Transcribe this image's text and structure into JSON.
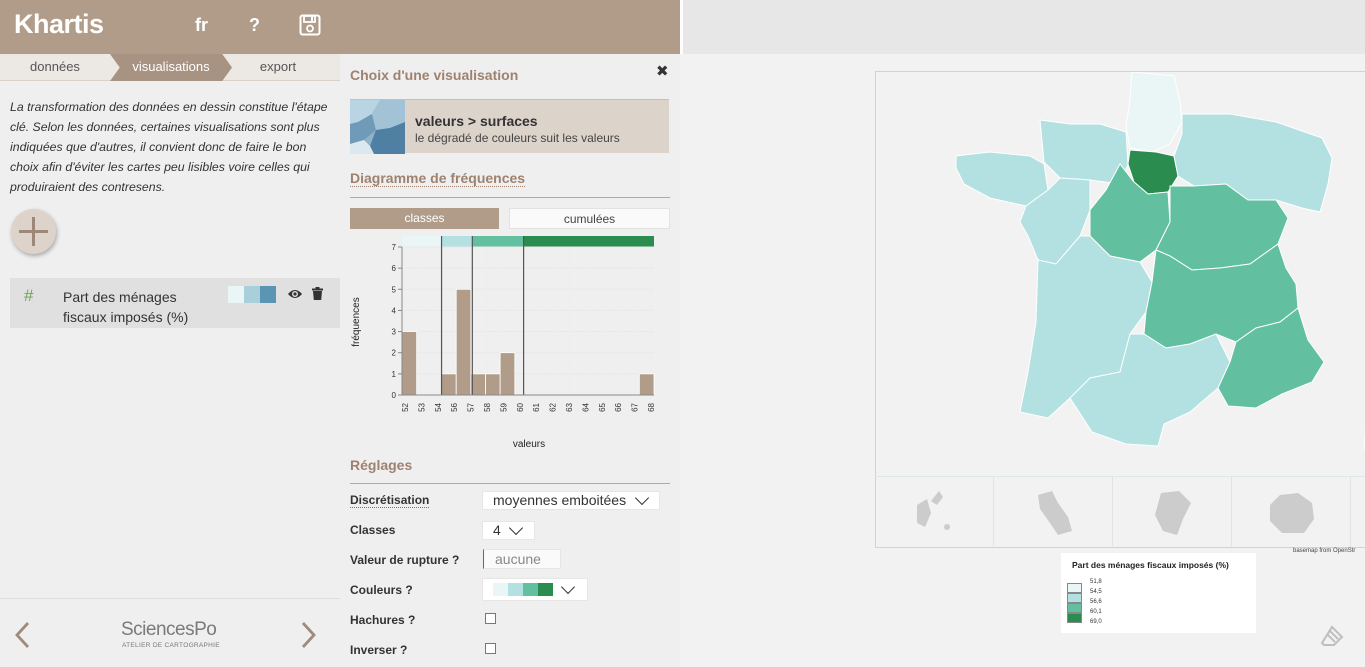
{
  "app": {
    "logo": "Khartis",
    "lang": "fr",
    "help": "?",
    "colors": {
      "accent": "#b19c8a",
      "accent_dark": "#9e8270",
      "accent_step": "#a89282"
    }
  },
  "steps": [
    {
      "label": "données",
      "active": false
    },
    {
      "label": "visualisations",
      "active": true
    },
    {
      "label": "export",
      "active": false
    }
  ],
  "intro": "La transformation des données en dessin constitue l'étape clé. Selon les données, certaines visualisations sont plus indiquées que d'autres, il convient donc de faire le bon choix afin d'éviter les cartes peu lisibles voire celles qui produiraient des contresens.",
  "layer": {
    "symbol": "#",
    "name": "Part des ménages fiscaux imposés (%)",
    "swatch": [
      "#eaf5f6",
      "#a9cfdb",
      "#5a95b4"
    ]
  },
  "footer": {
    "brand": "SciencesPo",
    "subtitle": "ATELIER DE CARTOGRAPHIE"
  },
  "choice": {
    "title": "Choix d'une visualisation",
    "vis_title": "valeurs > surfaces",
    "vis_desc": "le dégradé de couleurs suit les valeurs"
  },
  "freq": {
    "title": "Diagramme de fréquences",
    "tab_classes": "classes",
    "tab_cumul": "cumulées"
  },
  "chart_data": {
    "type": "bar",
    "xlabel": "valeurs",
    "ylabel": "fréquences",
    "x_ticks": [
      "52",
      "53",
      "54",
      "56",
      "57",
      "58",
      "59",
      "60",
      "61",
      "62",
      "63",
      "64",
      "65",
      "66",
      "67",
      "68"
    ],
    "yticks": [
      0,
      1,
      2,
      3,
      4,
      5,
      6,
      7
    ],
    "ylim": [
      0,
      7
    ],
    "xlim": [
      51.8,
      69.0
    ],
    "bins": [
      {
        "x0": 51.8,
        "x1": 52.8,
        "count": 3
      },
      {
        "x0": 54.5,
        "x1": 55.5,
        "count": 1
      },
      {
        "x0": 55.5,
        "x1": 56.5,
        "count": 5
      },
      {
        "x0": 56.5,
        "x1": 57.5,
        "count": 1
      },
      {
        "x0": 57.5,
        "x1": 58.5,
        "count": 1
      },
      {
        "x0": 58.5,
        "x1": 59.5,
        "count": 2
      },
      {
        "x0": 68.0,
        "x1": 69.0,
        "count": 1
      }
    ],
    "breaks": [
      54.5,
      56.6,
      60.1
    ],
    "class_colors": [
      "#eaf5f6",
      "#b3e0e0",
      "#62c0a0",
      "#2a8c4f"
    ]
  },
  "settings": {
    "title": "Réglages",
    "discretisation_label": "Discrétisation",
    "discretisation_value": "moyennes emboitées",
    "classes_label": "Classes",
    "classes_value": "4",
    "rupture_label": "Valeur de rupture ?",
    "rupture_placeholder": "aucune",
    "couleurs_label": "Couleurs ?",
    "couleurs_swatch": [
      "#eaf5f6",
      "#b3e0e0",
      "#62c0a0",
      "#2a8c4f"
    ],
    "hachures_label": "Hachures ?",
    "inverser_label": "Inverser ?"
  },
  "map": {
    "basemap_credit": "basemap from OpenStr",
    "legend_title": "Part des ménages fiscaux imposés (%)",
    "legend_values": [
      "51,8",
      "54,5",
      "56,6",
      "60,1",
      "69,0"
    ],
    "legend_colors": [
      "#eaf5f6",
      "#b3e0e0",
      "#62c0a0",
      "#2a8c4f"
    ],
    "region_colors": {
      "c1": "#eaf5f6",
      "c2": "#b3e0e0",
      "c3": "#62c0a0",
      "c4": "#2a8c4f"
    }
  }
}
